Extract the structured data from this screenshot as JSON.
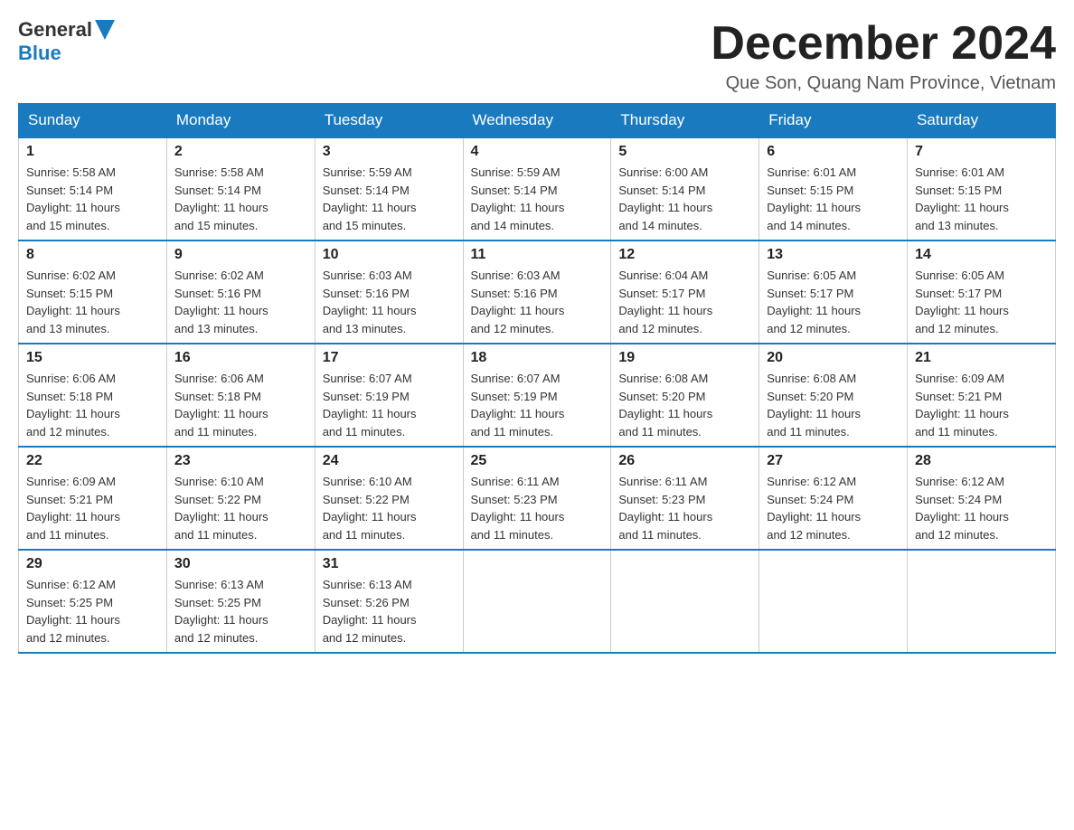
{
  "header": {
    "logo_general": "General",
    "logo_blue": "Blue",
    "month_title": "December 2024",
    "location": "Que Son, Quang Nam Province, Vietnam"
  },
  "calendar": {
    "days_of_week": [
      "Sunday",
      "Monday",
      "Tuesday",
      "Wednesday",
      "Thursday",
      "Friday",
      "Saturday"
    ],
    "weeks": [
      [
        {
          "day": "1",
          "sunrise": "5:58 AM",
          "sunset": "5:14 PM",
          "daylight": "11 hours and 15 minutes."
        },
        {
          "day": "2",
          "sunrise": "5:58 AM",
          "sunset": "5:14 PM",
          "daylight": "11 hours and 15 minutes."
        },
        {
          "day": "3",
          "sunrise": "5:59 AM",
          "sunset": "5:14 PM",
          "daylight": "11 hours and 15 minutes."
        },
        {
          "day": "4",
          "sunrise": "5:59 AM",
          "sunset": "5:14 PM",
          "daylight": "11 hours and 14 minutes."
        },
        {
          "day": "5",
          "sunrise": "6:00 AM",
          "sunset": "5:14 PM",
          "daylight": "11 hours and 14 minutes."
        },
        {
          "day": "6",
          "sunrise": "6:01 AM",
          "sunset": "5:15 PM",
          "daylight": "11 hours and 14 minutes."
        },
        {
          "day": "7",
          "sunrise": "6:01 AM",
          "sunset": "5:15 PM",
          "daylight": "11 hours and 13 minutes."
        }
      ],
      [
        {
          "day": "8",
          "sunrise": "6:02 AM",
          "sunset": "5:15 PM",
          "daylight": "11 hours and 13 minutes."
        },
        {
          "day": "9",
          "sunrise": "6:02 AM",
          "sunset": "5:16 PM",
          "daylight": "11 hours and 13 minutes."
        },
        {
          "day": "10",
          "sunrise": "6:03 AM",
          "sunset": "5:16 PM",
          "daylight": "11 hours and 13 minutes."
        },
        {
          "day": "11",
          "sunrise": "6:03 AM",
          "sunset": "5:16 PM",
          "daylight": "11 hours and 12 minutes."
        },
        {
          "day": "12",
          "sunrise": "6:04 AM",
          "sunset": "5:17 PM",
          "daylight": "11 hours and 12 minutes."
        },
        {
          "day": "13",
          "sunrise": "6:05 AM",
          "sunset": "5:17 PM",
          "daylight": "11 hours and 12 minutes."
        },
        {
          "day": "14",
          "sunrise": "6:05 AM",
          "sunset": "5:17 PM",
          "daylight": "11 hours and 12 minutes."
        }
      ],
      [
        {
          "day": "15",
          "sunrise": "6:06 AM",
          "sunset": "5:18 PM",
          "daylight": "11 hours and 12 minutes."
        },
        {
          "day": "16",
          "sunrise": "6:06 AM",
          "sunset": "5:18 PM",
          "daylight": "11 hours and 11 minutes."
        },
        {
          "day": "17",
          "sunrise": "6:07 AM",
          "sunset": "5:19 PM",
          "daylight": "11 hours and 11 minutes."
        },
        {
          "day": "18",
          "sunrise": "6:07 AM",
          "sunset": "5:19 PM",
          "daylight": "11 hours and 11 minutes."
        },
        {
          "day": "19",
          "sunrise": "6:08 AM",
          "sunset": "5:20 PM",
          "daylight": "11 hours and 11 minutes."
        },
        {
          "day": "20",
          "sunrise": "6:08 AM",
          "sunset": "5:20 PM",
          "daylight": "11 hours and 11 minutes."
        },
        {
          "day": "21",
          "sunrise": "6:09 AM",
          "sunset": "5:21 PM",
          "daylight": "11 hours and 11 minutes."
        }
      ],
      [
        {
          "day": "22",
          "sunrise": "6:09 AM",
          "sunset": "5:21 PM",
          "daylight": "11 hours and 11 minutes."
        },
        {
          "day": "23",
          "sunrise": "6:10 AM",
          "sunset": "5:22 PM",
          "daylight": "11 hours and 11 minutes."
        },
        {
          "day": "24",
          "sunrise": "6:10 AM",
          "sunset": "5:22 PM",
          "daylight": "11 hours and 11 minutes."
        },
        {
          "day": "25",
          "sunrise": "6:11 AM",
          "sunset": "5:23 PM",
          "daylight": "11 hours and 11 minutes."
        },
        {
          "day": "26",
          "sunrise": "6:11 AM",
          "sunset": "5:23 PM",
          "daylight": "11 hours and 11 minutes."
        },
        {
          "day": "27",
          "sunrise": "6:12 AM",
          "sunset": "5:24 PM",
          "daylight": "11 hours and 12 minutes."
        },
        {
          "day": "28",
          "sunrise": "6:12 AM",
          "sunset": "5:24 PM",
          "daylight": "11 hours and 12 minutes."
        }
      ],
      [
        {
          "day": "29",
          "sunrise": "6:12 AM",
          "sunset": "5:25 PM",
          "daylight": "11 hours and 12 minutes."
        },
        {
          "day": "30",
          "sunrise": "6:13 AM",
          "sunset": "5:25 PM",
          "daylight": "11 hours and 12 minutes."
        },
        {
          "day": "31",
          "sunrise": "6:13 AM",
          "sunset": "5:26 PM",
          "daylight": "11 hours and 12 minutes."
        },
        null,
        null,
        null,
        null
      ]
    ],
    "labels": {
      "sunrise": "Sunrise:",
      "sunset": "Sunset:",
      "daylight": "Daylight:"
    }
  }
}
